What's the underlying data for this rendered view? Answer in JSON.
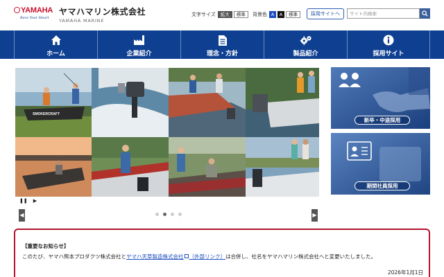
{
  "brand": {
    "logo_text": "YAMAHA",
    "tagline": "Revs Your Heart",
    "company_name": "ヤマハマリン株式会社",
    "company_name_en": "YAMAHA MARINE"
  },
  "utilities": {
    "font_size_label": "文字サイズ",
    "font_size_large": "拡大",
    "font_size_standard": "標準",
    "bg_color_label": "背景色",
    "bg_color_blue": "A",
    "bg_color_black": "A",
    "bg_color_standard": "標準",
    "recruit_site_button": "採用サイトへ",
    "search_placeholder": "サイト内検索"
  },
  "nav": {
    "items": [
      {
        "label": "ホーム",
        "icon": "home-icon"
      },
      {
        "label": "企業紹介",
        "icon": "factory-icon"
      },
      {
        "label": "理念・方針",
        "icon": "document-icon"
      },
      {
        "label": "製品紹介",
        "icon": "gears-icon"
      },
      {
        "label": "採用サイト",
        "icon": "info-icon"
      }
    ]
  },
  "slider": {
    "pause_symbol": "❚❚",
    "play_symbol": "▶",
    "prev_symbol": "◀",
    "next_symbol": "▶",
    "slide_count": 4,
    "active_slide": 2,
    "photo_texts": [
      "SMOKERCRAFT"
    ]
  },
  "banners": {
    "new_grad": {
      "label": "新卒・中途採用"
    },
    "seasonal": {
      "label": "期間社員採用"
    }
  },
  "notice": {
    "title": "【重要なお知らせ】",
    "text_before": "このたび、ヤマハ熊本プロダクツ株式会社と",
    "link_text": "ヤマハ天草製造株式会社",
    "link_suffix": "（外部リンク）",
    "text_after": "は合併し、社名をヤマハマリン株式会社へと変更いたしました。",
    "date": "2026年1月1日"
  },
  "colors": {
    "nav_bg": "#0e3f91",
    "brand_red": "#c8102e",
    "notice_border": "#b3112e",
    "link": "#1a4bbf"
  }
}
